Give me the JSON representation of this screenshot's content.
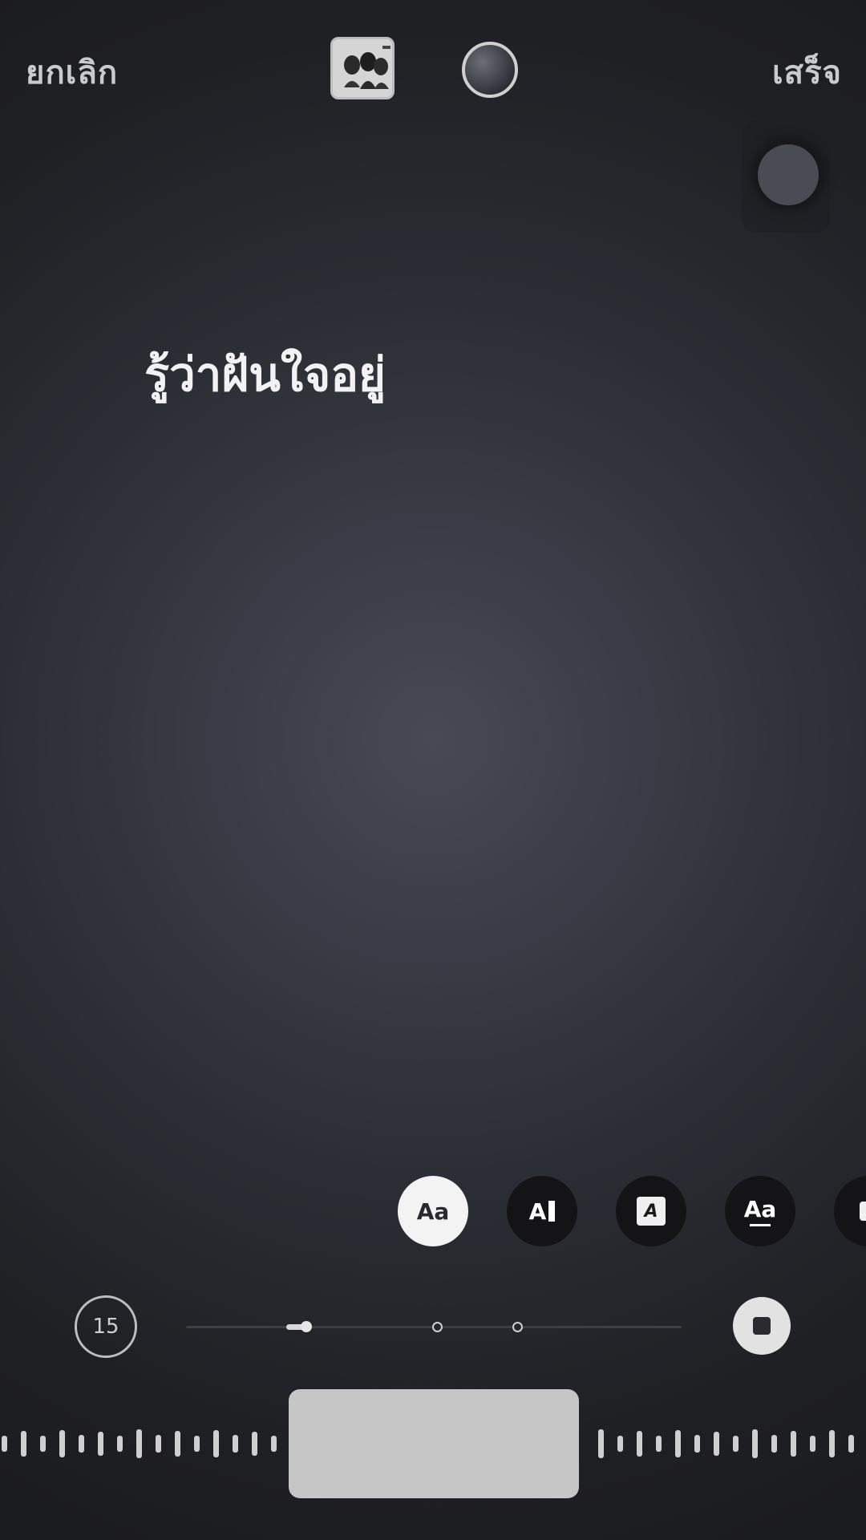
{
  "topbar": {
    "cancel_label": "ยกเลิก",
    "done_label": "เสร็จ",
    "sticker_icon": "photo-sticker-icon",
    "color_picker_icon": "color-dot-icon"
  },
  "canvas": {
    "text": "รู้ว่าฝันใจอยู่"
  },
  "text_styles": [
    {
      "label": "Aa",
      "icon": "text-style-classic-icon",
      "active": true
    },
    {
      "label": "A",
      "icon": "text-style-typewriter-icon",
      "active": false
    },
    {
      "label": "A",
      "icon": "text-style-background-icon",
      "active": false
    },
    {
      "label": "Aa",
      "icon": "text-style-underline-icon",
      "active": false
    },
    {
      "label": "",
      "icon": "text-style-more-icon",
      "active": false
    }
  ],
  "timeline": {
    "duration": "15",
    "progress_fraction": 0.24,
    "stop_icon": "stop-icon"
  },
  "colors": {
    "background_center": "#474a55",
    "background_edge": "#1a1b1e",
    "accent": "#f3f3f3"
  }
}
